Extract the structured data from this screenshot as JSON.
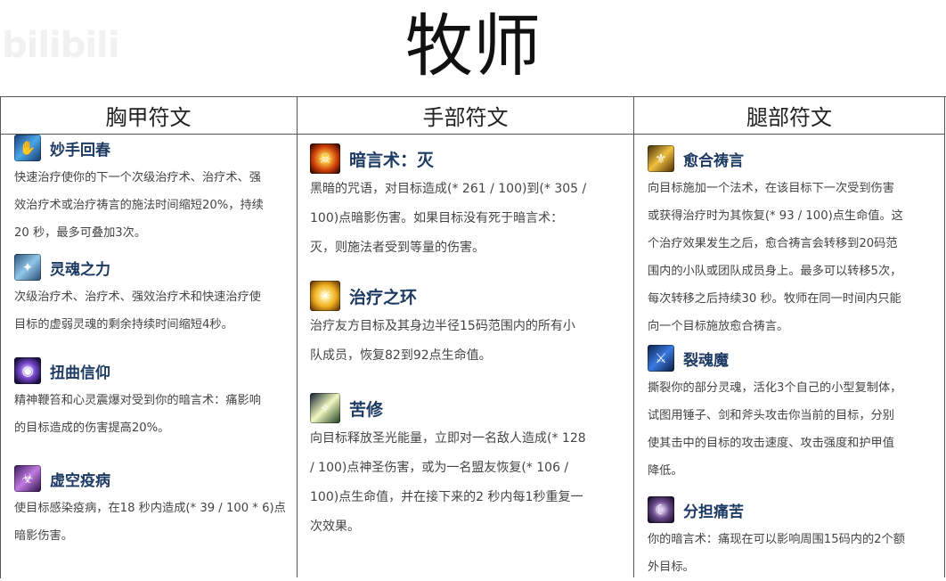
{
  "watermark": "bilibili",
  "title": "牧师",
  "columns": [
    {
      "header": "胸甲符文",
      "runes": [
        {
          "name": "妙手回春",
          "icon": "healing-hands-icon",
          "desc": "快速治疗使你的下一个次级治疗术、治疗术、强\n效治疗术或治疗祷言的施法时间缩短20%，持续\n20 秒，最多可叠加3次。"
        },
        {
          "name": "灵魂之力",
          "icon": "soul-strength-icon",
          "desc": "次级治疗术、治疗术、强效治疗术和快速治疗使\n目标的虚弱灵魂的剩余持续时间缩短4秒。"
        },
        {
          "name": "扭曲信仰",
          "icon": "twisted-faith-icon",
          "desc": "精神鞭笞和心灵震爆对受到你的暗言术：痛影响\n的目标造成的伤害提高20%。"
        },
        {
          "name": "虚空疫病",
          "icon": "void-plague-icon",
          "desc": "使目标感染疫病，在18 秒内造成(* 39 / 100 * 6)点\n暗影伤害。"
        }
      ]
    },
    {
      "header": "手部符文",
      "runes": [
        {
          "name": "暗言术：灭",
          "icon": "shadow-word-death-icon",
          "desc": "黑暗的咒语，对目标造成(* 261 / 100)到(* 305 /\n100)点暗影伤害。如果目标没有死于暗言术：\n灭，则施法者受到等量的伤害。"
        },
        {
          "name": "治疗之环",
          "icon": "circle-of-healing-icon",
          "desc": "治疗友方目标及其身边半径15码范围内的所有小\n队成员，恢复82到92点生命值。"
        },
        {
          "name": "苦修",
          "icon": "penance-icon",
          "desc": "向目标释放圣光能量，立即对一名敌人造成(* 128\n/ 100)点神圣伤害，或为一名盟友恢复(* 106 /\n100)点生命值，并在接下来的2 秒内每1秒重复一\n次效果。"
        }
      ]
    },
    {
      "header": "腿部符文",
      "runes": [
        {
          "name": "愈合祷言",
          "icon": "prayer-of-mending-icon",
          "desc": "向目标施加一个法术，在该目标下一次受到伤害\n或获得治疗时为其恢复(* 93 / 100)点生命值。这\n个治疗效果发生之后，愈合祷言会转移到20码范\n围内的小队或团队成员身上。最多可以转移5次，\n每次转移之后持续30 秒。牧师在同一时间内只能\n向一个目标施放愈合祷言。"
        },
        {
          "name": "裂魂魔",
          "icon": "shadowfiend-icon",
          "desc": "撕裂你的部分灵魂，活化3个自己的小型复制体，\n试图用锤子、剑和斧头攻击你当前的目标，分别\n使其击中的目标的攻击速度、攻击强度和护甲值\n降低。"
        },
        {
          "name": "分担痛苦",
          "icon": "shared-pain-icon",
          "desc": "你的暗言术：痛现在可以影响周围15码内的2个额\n外目标。"
        }
      ]
    }
  ],
  "colors": {
    "rune_name": "#1d3a63",
    "desc_text": "#444444",
    "border": "#555555"
  }
}
